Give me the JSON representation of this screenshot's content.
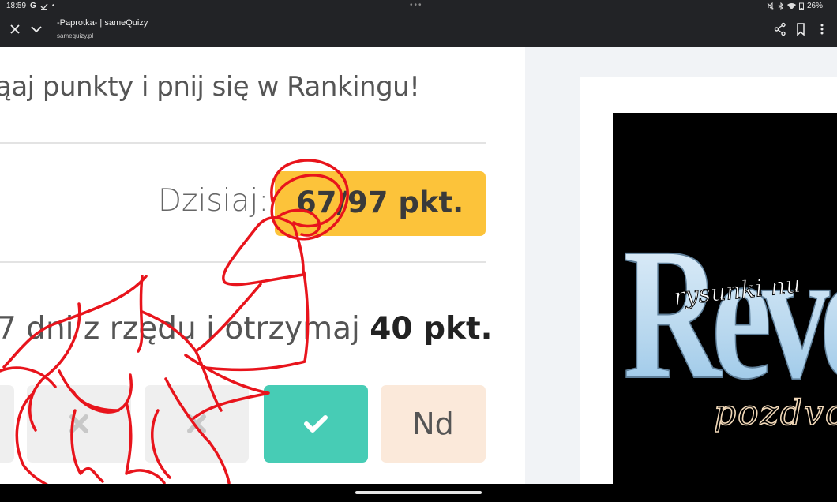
{
  "status": {
    "time": "18:59",
    "battery": "26%"
  },
  "browser": {
    "title": "-Paprotka- | sameQuizy",
    "url": "samequizy.pl"
  },
  "main": {
    "headline": "ąaj punkty i pnij się w Rankingu!",
    "today_label": "Dzisiaj:",
    "today_value": "67/97 pkt.",
    "streak_text": "7 dni z rzędu i otrzymaj ",
    "streak_points": "40 pkt.",
    "days": [
      {
        "state": "missed",
        "icon": "cross-icon"
      },
      {
        "state": "missed",
        "icon": "cross-icon"
      },
      {
        "state": "missed",
        "icon": "cross-icon"
      },
      {
        "state": "done",
        "icon": "check-icon"
      },
      {
        "state": "pending",
        "label": "Nd"
      }
    ]
  },
  "ad": {
    "title": "Reve",
    "subtitle": "rysunki nu",
    "footer": "pozdvo"
  },
  "colors": {
    "accent_yellow": "#fcc33a",
    "done_teal": "#47ccb5",
    "pending_peach": "#fbe9da",
    "scribble_red": "#e8141c"
  }
}
